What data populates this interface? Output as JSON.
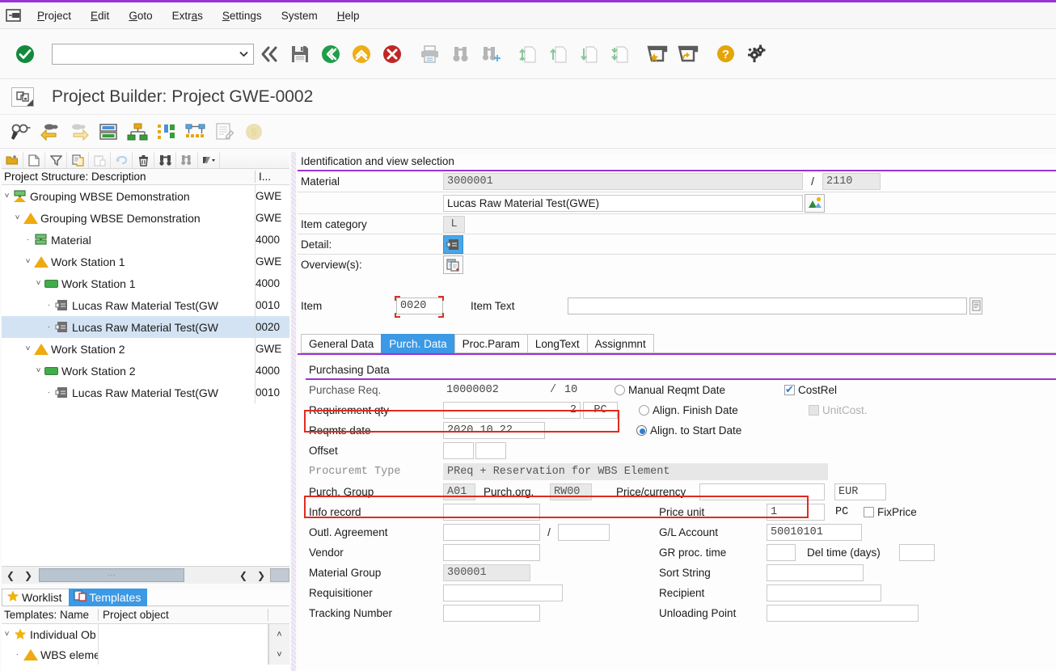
{
  "app": {
    "title": "Project Builder: Project GWE-0002",
    "accent_color": "#9b32d6"
  },
  "menu": {
    "items": [
      {
        "label": "Project",
        "accel": "P"
      },
      {
        "label": "Edit",
        "accel": "E"
      },
      {
        "label": "Goto",
        "accel": "G"
      },
      {
        "label": "Extras",
        "accel": "a"
      },
      {
        "label": "Settings",
        "accel": "S"
      },
      {
        "label": "System",
        "accel": ""
      },
      {
        "label": "Help",
        "accel": "H"
      }
    ]
  },
  "toolbar": {
    "command_value": "",
    "icons": [
      "enter-check-icon",
      "back-double-icon",
      "save-icon",
      "back-green-icon",
      "up-yellow-icon",
      "cancel-red-icon",
      "print-icon",
      "find-icon",
      "find-next-icon",
      "first-page-icon",
      "previous-page-icon",
      "next-page-icon",
      "last-page-icon",
      "create-favorite-icon",
      "customize-local-layout-icon",
      "help-icon",
      "settings-gear-icon"
    ]
  },
  "toolbar2": {
    "icons": [
      "display-change-icon",
      "previous-object-icon",
      "next-object-icon",
      "project-definition-icon",
      "hierarchy-graphic-icon",
      "gantt-chart-icon",
      "network-graphic-icon",
      "worklist-icon",
      "status-icon"
    ]
  },
  "tree": {
    "toolbar_icons": [
      "open-project-icon",
      "create-icon",
      "filter-icon",
      "copy-icon",
      "paste-icon",
      "undo-icon",
      "delete-icon",
      "find-icon",
      "find-next-icon",
      "more-options-icon"
    ],
    "columns": {
      "description": "Project Structure: Description",
      "id": "I..."
    },
    "rows": [
      {
        "indent": 0,
        "twisty": "˅",
        "icon": "project-definition-icon",
        "label": "Grouping WBSE Demonstration",
        "id": "GWE",
        "selected": false
      },
      {
        "indent": 1,
        "twisty": "˅",
        "icon": "wbs-element-icon",
        "label": "Grouping WBSE Demonstration",
        "id": "GWE",
        "selected": false
      },
      {
        "indent": 2,
        "twisty": "·",
        "icon": "material-icon",
        "label": "Material",
        "id": "4000",
        "selected": false
      },
      {
        "indent": 2,
        "twisty": "˅",
        "icon": "wbs-element-icon",
        "label": "Work Station 1",
        "id": "GWE",
        "selected": false
      },
      {
        "indent": 3,
        "twisty": "˅",
        "icon": "activity-icon",
        "label": "Work Station 1",
        "id": "4000",
        "selected": false
      },
      {
        "indent": 4,
        "twisty": "·",
        "icon": "component-icon",
        "label": "Lucas Raw Material Test(GW",
        "id": "0010",
        "selected": false
      },
      {
        "indent": 4,
        "twisty": "·",
        "icon": "component-icon",
        "label": "Lucas Raw Material Test(GW",
        "id": "0020",
        "selected": true
      },
      {
        "indent": 2,
        "twisty": "˅",
        "icon": "wbs-element-icon",
        "label": "Work Station 2",
        "id": "GWE",
        "selected": false
      },
      {
        "indent": 3,
        "twisty": "˅",
        "icon": "activity-icon",
        "label": "Work Station 2",
        "id": "4000",
        "selected": false
      },
      {
        "indent": 4,
        "twisty": "·",
        "icon": "component-icon",
        "label": "Lucas Raw Material Test(GW",
        "id": "0010",
        "selected": false
      }
    ]
  },
  "bottom_panel": {
    "tabs": [
      {
        "label": "Worklist",
        "icon": "star-icon",
        "active": false
      },
      {
        "label": "Templates",
        "icon": "templates-icon",
        "active": true
      }
    ],
    "columns": {
      "name": "Templates: Name",
      "object": "Project object"
    },
    "rows": [
      {
        "indent": 0,
        "twisty": "˅",
        "icon": "star-icon",
        "label": "Individual Ob",
        "object": ""
      },
      {
        "indent": 1,
        "twisty": "·",
        "icon": "wbs-element-icon",
        "label": "WBS eleme",
        "object": ""
      }
    ],
    "scroll_up": "˄",
    "scroll_down": "˅"
  },
  "identification": {
    "section_title": "Identification and view selection",
    "material_label": "Material",
    "material_value": "3000001",
    "separator": "/",
    "plant_value": "2110",
    "description_value": "Lucas Raw Material Test(GWE)",
    "plant_button_icon": "plant-view-icon",
    "item_category_label": "Item category",
    "item_category_value": "L",
    "detail_label": "Detail:",
    "detail_button_icon": "component-detail-icon",
    "overviews_label": "Overview(s):",
    "overviews_button_icon": "overview-icon"
  },
  "item_bar": {
    "item_label": "Item",
    "item_value": "0020",
    "item_text_label": "Item Text",
    "item_text_value": "",
    "item_text_button_icon": "long-text-icon"
  },
  "tabs": [
    {
      "label": "General Data",
      "active": false
    },
    {
      "label": "Purch. Data",
      "active": true
    },
    {
      "label": "Proc.Param",
      "active": false
    },
    {
      "label": "LongText",
      "active": false
    },
    {
      "label": "Assignmnt",
      "active": false
    }
  ],
  "purchasing": {
    "section_title": "Purchasing Data",
    "left_fields": [
      {
        "label": "Purchase Req.",
        "value": "10000002",
        "sep": "/",
        "value2": "10",
        "readonly": true,
        "style": "plain"
      },
      {
        "label": "Requirement qty",
        "value": "2",
        "unit": "PC",
        "readonly": false,
        "align": "right"
      },
      {
        "label": "Reqmts date",
        "value": "2020.10.22",
        "readonly": false
      },
      {
        "label": "Offset",
        "value": "",
        "value2": "",
        "readonly": false
      },
      {
        "label": "Procuremt Type",
        "value": "PReq + Reservation for WBS Element",
        "readonly": true
      },
      {
        "label": "Purch. Group",
        "value": "A01",
        "label2": "Purch.org.",
        "value2": "RW00",
        "readonly": true
      },
      {
        "label": "Info record",
        "value": "",
        "readonly": false
      },
      {
        "label": "Outl. Agreement",
        "value": "",
        "sep": "/",
        "value2": "",
        "readonly": false
      },
      {
        "label": "Vendor",
        "value": "",
        "readonly": false
      },
      {
        "label": "Material Group",
        "value": "300001",
        "readonly": true
      },
      {
        "label": "Requisitioner",
        "value": "",
        "readonly": false
      },
      {
        "label": "Tracking Number",
        "value": "",
        "readonly": false
      }
    ],
    "radio_options": [
      {
        "label": "Manual Reqmt Date",
        "selected": false
      },
      {
        "label": "Align. Finish Date",
        "selected": false
      },
      {
        "label": "Align. to Start Date",
        "selected": true
      }
    ],
    "checkboxes": [
      {
        "label": "CostRel",
        "checked": true,
        "disabled": false
      },
      {
        "label": "UnitCost.",
        "checked": false,
        "disabled": true
      }
    ],
    "right_fields": [
      {
        "label": "Price/currency",
        "value": "",
        "value2": "EUR"
      },
      {
        "label": "Price unit",
        "value": "1",
        "unit": "PC",
        "checkbox": {
          "label": "FixPrice",
          "checked": false
        }
      },
      {
        "label": "G/L Account",
        "value": "50010101",
        "readonly": false
      },
      {
        "label": "GR proc. time",
        "value": "",
        "label2": "Del time (days)",
        "value2": ""
      },
      {
        "label": "Sort String",
        "value": ""
      },
      {
        "label": "Recipient",
        "value": ""
      },
      {
        "label": "Unloading Point",
        "value": ""
      }
    ]
  },
  "highlights": {
    "color": "#e02b1e",
    "boxes": [
      "purchase-req-row",
      "procurement-type-row"
    ]
  }
}
